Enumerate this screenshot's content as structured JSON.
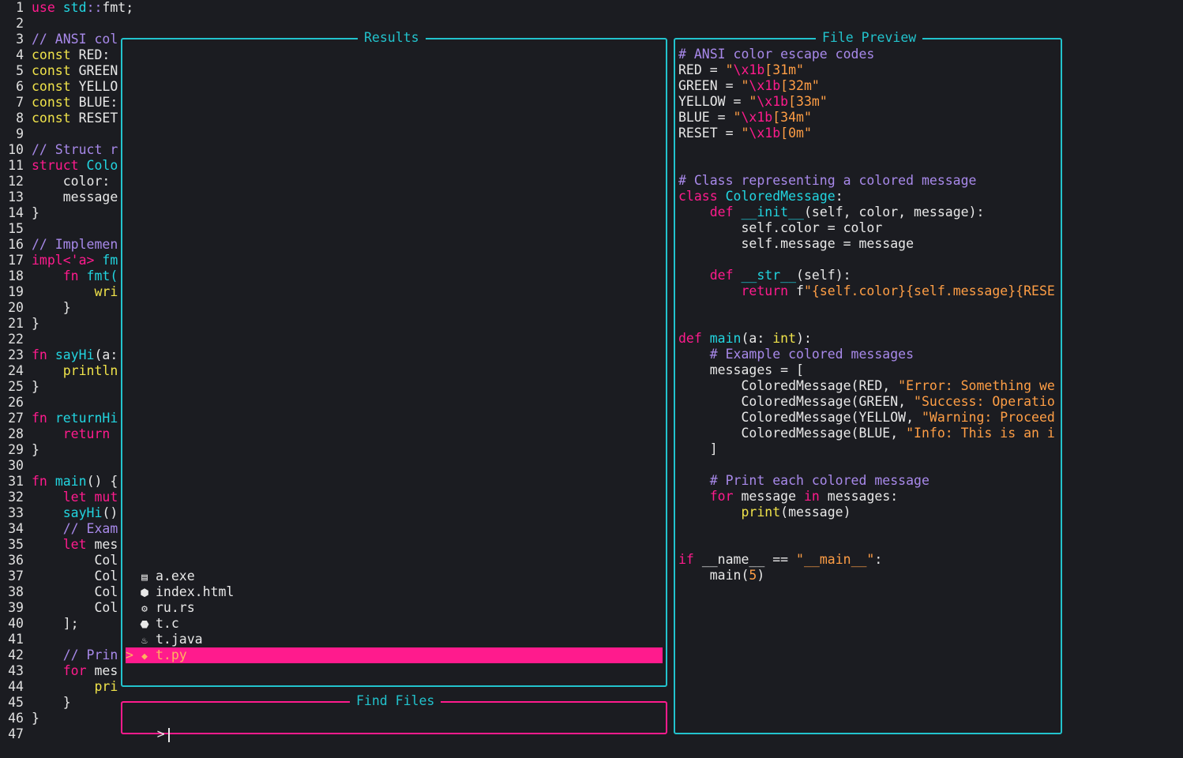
{
  "editor": {
    "lines": [
      {
        "n": "1",
        "segs": [
          {
            "t": "use ",
            "c": "k"
          },
          {
            "t": "std",
            "c": "t"
          },
          {
            "t": "::",
            "c": "c"
          },
          {
            "t": "fmt;",
            "c": ""
          }
        ]
      },
      {
        "n": "2",
        "segs": []
      },
      {
        "n": "3",
        "segs": [
          {
            "t": "// ANSI col",
            "c": "c"
          }
        ]
      },
      {
        "n": "4",
        "segs": [
          {
            "t": "const ",
            "c": "y"
          },
          {
            "t": "RED:",
            "c": ""
          }
        ]
      },
      {
        "n": "5",
        "segs": [
          {
            "t": "const ",
            "c": "y"
          },
          {
            "t": "GREEN",
            "c": ""
          }
        ]
      },
      {
        "n": "6",
        "segs": [
          {
            "t": "const ",
            "c": "y"
          },
          {
            "t": "YELLO",
            "c": ""
          }
        ]
      },
      {
        "n": "7",
        "segs": [
          {
            "t": "const ",
            "c": "y"
          },
          {
            "t": "BLUE:",
            "c": ""
          }
        ]
      },
      {
        "n": "8",
        "segs": [
          {
            "t": "const ",
            "c": "y"
          },
          {
            "t": "RESET",
            "c": ""
          }
        ]
      },
      {
        "n": "9",
        "segs": []
      },
      {
        "n": "10",
        "segs": [
          {
            "t": "// Struct r",
            "c": "c"
          }
        ]
      },
      {
        "n": "11",
        "segs": [
          {
            "t": "struct ",
            "c": "k"
          },
          {
            "t": "Colo",
            "c": "t"
          }
        ]
      },
      {
        "n": "12",
        "segs": [
          {
            "t": "    color:",
            "c": ""
          }
        ]
      },
      {
        "n": "13",
        "segs": [
          {
            "t": "    message",
            "c": ""
          }
        ]
      },
      {
        "n": "14",
        "segs": [
          {
            "t": "}",
            "c": ""
          }
        ]
      },
      {
        "n": "15",
        "segs": []
      },
      {
        "n": "16",
        "segs": [
          {
            "t": "// Implemen",
            "c": "c"
          }
        ]
      },
      {
        "n": "17",
        "segs": [
          {
            "t": "impl<'a> ",
            "c": "k"
          },
          {
            "t": "fm",
            "c": "t"
          }
        ]
      },
      {
        "n": "18",
        "segs": [
          {
            "t": "    fn ",
            "c": "k"
          },
          {
            "t": "fmt(",
            "c": "t"
          }
        ]
      },
      {
        "n": "19",
        "segs": [
          {
            "t": "        wri",
            "c": "y"
          }
        ]
      },
      {
        "n": "20",
        "segs": [
          {
            "t": "    }",
            "c": ""
          }
        ]
      },
      {
        "n": "21",
        "segs": [
          {
            "t": "}",
            "c": ""
          }
        ]
      },
      {
        "n": "22",
        "segs": []
      },
      {
        "n": "23",
        "segs": [
          {
            "t": "fn ",
            "c": "k"
          },
          {
            "t": "sayHi",
            "c": "t"
          },
          {
            "t": "(a:",
            "c": ""
          }
        ]
      },
      {
        "n": "24",
        "segs": [
          {
            "t": "    println",
            "c": "y"
          }
        ]
      },
      {
        "n": "25",
        "segs": [
          {
            "t": "}",
            "c": ""
          }
        ]
      },
      {
        "n": "26",
        "segs": []
      },
      {
        "n": "27",
        "segs": [
          {
            "t": "fn ",
            "c": "k"
          },
          {
            "t": "returnHi",
            "c": "t"
          }
        ]
      },
      {
        "n": "28",
        "segs": [
          {
            "t": "    return ",
            "c": "k"
          }
        ]
      },
      {
        "n": "29",
        "segs": [
          {
            "t": "}",
            "c": ""
          }
        ]
      },
      {
        "n": "30",
        "segs": []
      },
      {
        "n": "31",
        "segs": [
          {
            "t": "fn ",
            "c": "k"
          },
          {
            "t": "main",
            "c": "t"
          },
          {
            "t": "() {",
            "c": ""
          }
        ]
      },
      {
        "n": "32",
        "segs": [
          {
            "t": "    let mut",
            "c": "k"
          }
        ]
      },
      {
        "n": "33",
        "segs": [
          {
            "t": "    sayHi",
            "c": "t"
          },
          {
            "t": "()",
            "c": ""
          }
        ]
      },
      {
        "n": "34",
        "segs": [
          {
            "t": "    // Exam",
            "c": "c"
          }
        ]
      },
      {
        "n": "35",
        "segs": [
          {
            "t": "    let ",
            "c": "k"
          },
          {
            "t": "mes",
            "c": ""
          }
        ]
      },
      {
        "n": "36",
        "segs": [
          {
            "t": "        Col",
            "c": ""
          }
        ]
      },
      {
        "n": "37",
        "segs": [
          {
            "t": "        Col",
            "c": ""
          }
        ]
      },
      {
        "n": "38",
        "segs": [
          {
            "t": "        Col",
            "c": ""
          }
        ]
      },
      {
        "n": "39",
        "segs": [
          {
            "t": "        Col",
            "c": ""
          }
        ]
      },
      {
        "n": "40",
        "segs": [
          {
            "t": "    ];",
            "c": ""
          }
        ]
      },
      {
        "n": "41",
        "segs": []
      },
      {
        "n": "42",
        "segs": [
          {
            "t": "    // Prin",
            "c": "c"
          }
        ]
      },
      {
        "n": "43",
        "segs": [
          {
            "t": "    for ",
            "c": "k"
          },
          {
            "t": "mes",
            "c": ""
          }
        ]
      },
      {
        "n": "44",
        "segs": [
          {
            "t": "        pri",
            "c": "y"
          }
        ]
      },
      {
        "n": "45",
        "segs": [
          {
            "t": "    }",
            "c": ""
          }
        ]
      },
      {
        "n": "46",
        "segs": [
          {
            "t": "}",
            "c": ""
          }
        ]
      },
      {
        "n": "47",
        "segs": []
      }
    ]
  },
  "results": {
    "title": "Results",
    "items": [
      {
        "icon": "binary-file-icon",
        "glyph": "▤",
        "name": "a.exe",
        "selected": false
      },
      {
        "icon": "html5-icon",
        "glyph": "⬢",
        "name": "index.html",
        "selected": false
      },
      {
        "icon": "rust-icon",
        "glyph": "⚙",
        "name": "ru.rs",
        "selected": false
      },
      {
        "icon": "c-language-icon",
        "glyph": "⬣",
        "name": "t.c",
        "selected": false
      },
      {
        "icon": "java-icon",
        "glyph": "♨",
        "name": "t.java",
        "selected": false
      },
      {
        "icon": "python-icon",
        "glyph": "◆",
        "name": "t.py",
        "selected": true
      }
    ],
    "selection_marker": ">"
  },
  "find": {
    "title": "Find Files",
    "prompt": ">",
    "value": ""
  },
  "preview": {
    "title": "File Preview",
    "lines": [
      [
        {
          "t": "# ANSI color escape codes",
          "c": "c"
        }
      ],
      [
        {
          "t": "RED = ",
          "c": ""
        },
        {
          "t": "\"",
          "c": "s"
        },
        {
          "t": "\\x1b",
          "c": "p"
        },
        {
          "t": "[31m\"",
          "c": "s"
        }
      ],
      [
        {
          "t": "GREEN = ",
          "c": ""
        },
        {
          "t": "\"",
          "c": "s"
        },
        {
          "t": "\\x1b",
          "c": "p"
        },
        {
          "t": "[32m\"",
          "c": "s"
        }
      ],
      [
        {
          "t": "YELLOW = ",
          "c": ""
        },
        {
          "t": "\"",
          "c": "s"
        },
        {
          "t": "\\x1b",
          "c": "p"
        },
        {
          "t": "[33m\"",
          "c": "s"
        }
      ],
      [
        {
          "t": "BLUE = ",
          "c": ""
        },
        {
          "t": "\"",
          "c": "s"
        },
        {
          "t": "\\x1b",
          "c": "p"
        },
        {
          "t": "[34m\"",
          "c": "s"
        }
      ],
      [
        {
          "t": "RESET = ",
          "c": ""
        },
        {
          "t": "\"",
          "c": "s"
        },
        {
          "t": "\\x1b",
          "c": "p"
        },
        {
          "t": "[0m\"",
          "c": "s"
        }
      ],
      [],
      [],
      [
        {
          "t": "# Class representing a colored message",
          "c": "c"
        }
      ],
      [
        {
          "t": "class ",
          "c": "k"
        },
        {
          "t": "ColoredMessage",
          "c": "t"
        },
        {
          "t": ":",
          "c": ""
        }
      ],
      [
        {
          "t": "    def ",
          "c": "k"
        },
        {
          "t": "__init__",
          "c": "t"
        },
        {
          "t": "(self, color, message):",
          "c": ""
        }
      ],
      [
        {
          "t": "        self.color = color",
          "c": ""
        }
      ],
      [
        {
          "t": "        self.message = message",
          "c": ""
        }
      ],
      [],
      [
        {
          "t": "    def ",
          "c": "k"
        },
        {
          "t": "__str__",
          "c": "t"
        },
        {
          "t": "(self):",
          "c": ""
        }
      ],
      [
        {
          "t": "        return ",
          "c": "k"
        },
        {
          "t": "f",
          "c": ""
        },
        {
          "t": "\"{self.color}{self.message}{RESE",
          "c": "s"
        }
      ],
      [],
      [],
      [
        {
          "t": "def ",
          "c": "k"
        },
        {
          "t": "main",
          "c": "t"
        },
        {
          "t": "(a: ",
          "c": ""
        },
        {
          "t": "int",
          "c": "y"
        },
        {
          "t": "):",
          "c": ""
        }
      ],
      [
        {
          "t": "    # Example colored messages",
          "c": "c"
        }
      ],
      [
        {
          "t": "    messages = [",
          "c": ""
        }
      ],
      [
        {
          "t": "        ColoredMessage(RED, ",
          "c": ""
        },
        {
          "t": "\"Error: Something we",
          "c": "s"
        }
      ],
      [
        {
          "t": "        ColoredMessage(GREEN, ",
          "c": ""
        },
        {
          "t": "\"Success: Operatio",
          "c": "s"
        }
      ],
      [
        {
          "t": "        ColoredMessage(YELLOW, ",
          "c": ""
        },
        {
          "t": "\"Warning: Proceed",
          "c": "s"
        }
      ],
      [
        {
          "t": "        ColoredMessage(BLUE, ",
          "c": ""
        },
        {
          "t": "\"Info: This is an i",
          "c": "s"
        }
      ],
      [
        {
          "t": "    ]",
          "c": ""
        }
      ],
      [],
      [
        {
          "t": "    # Print each colored message",
          "c": "c"
        }
      ],
      [
        {
          "t": "    for ",
          "c": "k"
        },
        {
          "t": "message ",
          "c": ""
        },
        {
          "t": "in ",
          "c": "k"
        },
        {
          "t": "messages:",
          "c": ""
        }
      ],
      [
        {
          "t": "        print",
          "c": "y"
        },
        {
          "t": "(message)",
          "c": ""
        }
      ],
      [],
      [],
      [
        {
          "t": "if ",
          "c": "k"
        },
        {
          "t": "__name__ == ",
          "c": ""
        },
        {
          "t": "\"__main__\"",
          "c": "s"
        },
        {
          "t": ":",
          "c": ""
        }
      ],
      [
        {
          "t": "    main(",
          "c": ""
        },
        {
          "t": "5",
          "c": "s"
        },
        {
          "t": ")",
          "c": ""
        }
      ]
    ]
  }
}
